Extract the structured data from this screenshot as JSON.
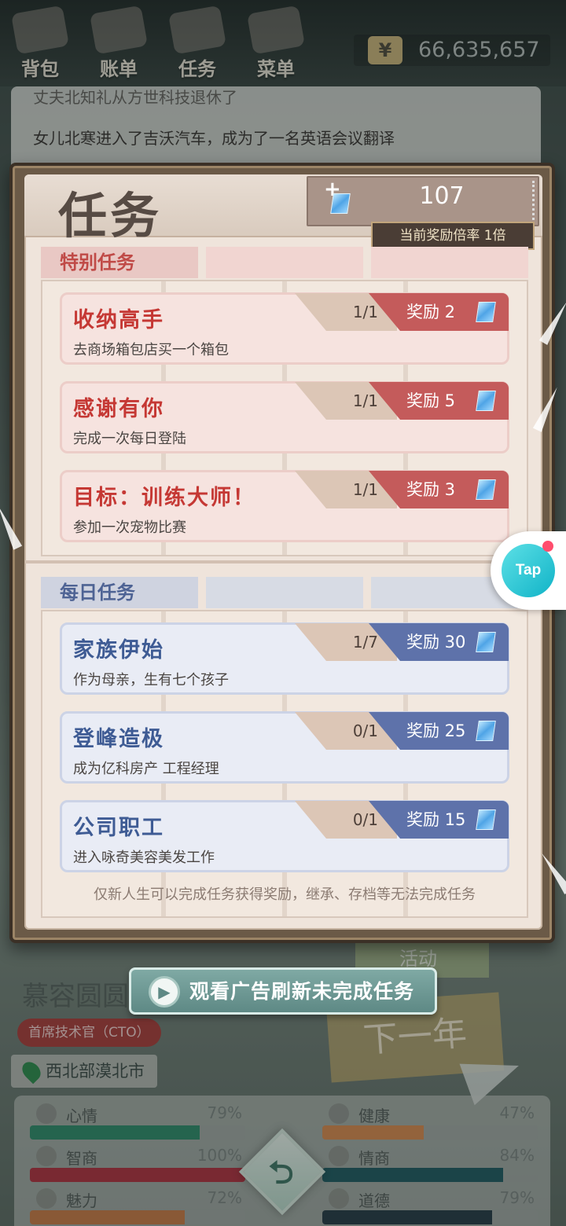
{
  "nav": [
    {
      "label": "背包",
      "icon": "backpack-icon"
    },
    {
      "label": "账单",
      "icon": "bill-icon"
    },
    {
      "label": "任务",
      "icon": "task-icon"
    },
    {
      "label": "菜单",
      "icon": "menu-icon"
    }
  ],
  "money": {
    "symbol": "¥",
    "amount": "66,635,657"
  },
  "log": {
    "faded_line": "丈夫北知礼从方世科技退休了",
    "line": "女儿北寒进入了吉沃汽车，成为了一名英语会议翻译"
  },
  "panel": {
    "title": "任务",
    "gems": "107",
    "plus": "+",
    "multiplier": "当前奖励倍率 1倍",
    "special_tab": "特别任务",
    "daily_tab": "每日任务",
    "footnote": "仅新人生可以完成任务获得奖励，继承、存档等无法完成任务"
  },
  "special_tasks": [
    {
      "name": "收纳高手",
      "desc": "去商场箱包店买一个箱包",
      "progress": "1/1",
      "reward": "奖励 2"
    },
    {
      "name": "感谢有你",
      "desc": "完成一次每日登陆",
      "progress": "1/1",
      "reward": "奖励 5"
    },
    {
      "name": "目标：训练大师！",
      "desc": "参加一次宠物比赛",
      "progress": "1/1",
      "reward": "奖励 3"
    }
  ],
  "daily_tasks": [
    {
      "name": "家族伊始",
      "desc": "作为母亲，生有七个孩子",
      "progress": "1/7",
      "reward": "奖励 30"
    },
    {
      "name": "登峰造极",
      "desc": "成为亿科房产 工程经理",
      "progress": "0/1",
      "reward": "奖励 25"
    },
    {
      "name": "公司职工",
      "desc": "进入咏奇美容美发工作",
      "progress": "0/1",
      "reward": "奖励 15"
    }
  ],
  "ad_button": {
    "label": "观看广告刷新未完成任务",
    "icon": "play-icon"
  },
  "tap_button": {
    "label": "Tap"
  },
  "character": {
    "name": "慕容圆圆",
    "title": "首席技术官（CTO）",
    "location": "西北部漠北市"
  },
  "activity": "活动",
  "next_year": "下一年",
  "stats": [
    {
      "label": "心情",
      "value": "79%",
      "level": 0.79,
      "color": "#2f8a6a",
      "icon": "smile-icon"
    },
    {
      "label": "健康",
      "value": "47%",
      "level": 0.47,
      "color": "#d8894f",
      "icon": "heart-icon"
    },
    {
      "label": "智商",
      "value": "100%",
      "level": 1.0,
      "color": "#b03040",
      "icon": "bulb-icon"
    },
    {
      "label": "情商",
      "value": "84%",
      "level": 0.84,
      "color": "#1f5a62",
      "icon": "apple-icon"
    },
    {
      "label": "魅力",
      "value": "72%",
      "level": 0.72,
      "color": "#c87a45",
      "icon": "sparkle-icon"
    },
    {
      "label": "道德",
      "value": "79%",
      "level": 0.79,
      "color": "#253a46",
      "icon": "scale-icon"
    }
  ],
  "back_button": {
    "glyph": "⮌"
  },
  "colors": {
    "special_accent": "#c53834",
    "daily_accent": "#3e5b94",
    "gem": "#4fa4e6"
  }
}
